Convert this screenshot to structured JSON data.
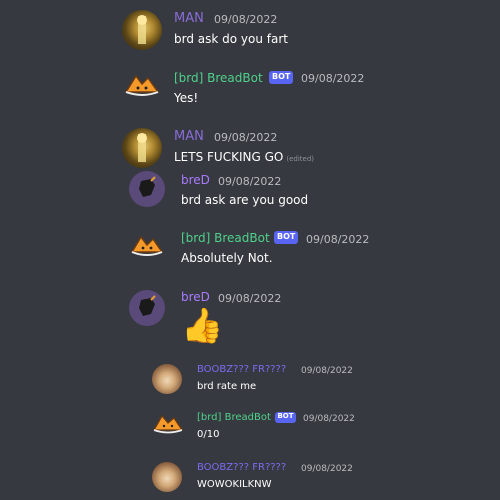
{
  "messages": [
    {
      "author": "MAN",
      "time": "09/08/2022",
      "text": "brd ask do you fart"
    },
    {
      "author": "[brd] BreadBot",
      "badge": "BOT",
      "time": "09/08/2022",
      "text": "Yes!"
    },
    {
      "author": "MAN",
      "time": "09/08/2022",
      "text": "LETS FUCKING GO",
      "edited": "(edited)"
    },
    {
      "author": "breD",
      "time": "09/08/2022",
      "text": "brd ask are you good"
    },
    {
      "author": "[brd] BreadBot",
      "badge": "BOT",
      "time": "09/08/2022",
      "text": "Absolutely Not."
    },
    {
      "author": "breD",
      "time": "09/08/2022",
      "emoji": "👍"
    },
    {
      "author": "BOOBZ??? FR????",
      "time": "09/08/2022",
      "text": "brd rate me"
    },
    {
      "author": "[brd] BreadBot",
      "badge": "BOT",
      "time": "09/08/2022",
      "text": "0/10"
    },
    {
      "author": "BOOBZ??? FR????",
      "time": "09/08/2022",
      "text": "WOWOKILKNW"
    }
  ],
  "colors": {
    "background": "#36393f",
    "man": "#8a6cd8",
    "bot": "#4fd18b",
    "bred": "#a97bff",
    "boobz": "#7b6cf0",
    "badge": "#5865f2"
  }
}
